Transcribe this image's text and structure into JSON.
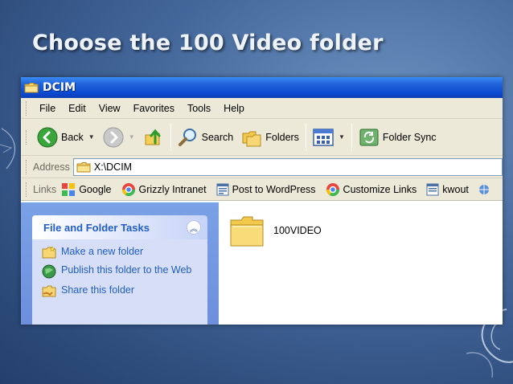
{
  "slide": {
    "title": "Choose the 100 Video folder"
  },
  "window": {
    "title": "DCIM",
    "menu": [
      "File",
      "Edit",
      "View",
      "Favorites",
      "Tools",
      "Help"
    ],
    "toolbar": {
      "back_label": "Back",
      "search_label": "Search",
      "folders_label": "Folders",
      "folder_sync_label": "Folder Sync"
    },
    "address": {
      "label": "Address",
      "value": "X:\\DCIM"
    },
    "links": {
      "label": "Links",
      "items": [
        "Google",
        "Grizzly Intranet",
        "Post to WordPress",
        "Customize Links",
        "kwout"
      ]
    },
    "task_pane": {
      "heading": "File and Folder Tasks",
      "items": [
        "Make a new folder",
        "Publish this folder to the Web",
        "Share this folder"
      ]
    },
    "files": [
      {
        "name": "100VIDEO",
        "icon": "folder-icon"
      }
    ]
  },
  "colors": {
    "background": "#44679a",
    "titlebar": "#0a48cf",
    "task_pane": "#7aa1e6",
    "task_link": "#215dc6"
  }
}
